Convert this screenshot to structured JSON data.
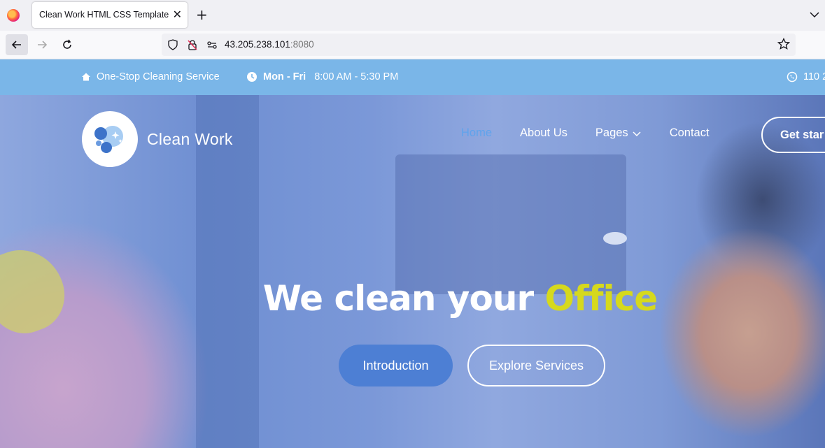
{
  "browser": {
    "tab_title": "Clean Work HTML CSS Template",
    "url_host": "43.205.238.101",
    "url_port": ":8080"
  },
  "topbar": {
    "service": "One-Stop Cleaning Service",
    "days": "Mon - Fri",
    "hours": "8:00 AM - 5:30 PM",
    "phone": "110 2"
  },
  "site": {
    "brand": "Clean Work"
  },
  "nav": {
    "items": [
      {
        "label": "Home",
        "active": true
      },
      {
        "label": "About Us"
      },
      {
        "label": "Pages"
      },
      {
        "label": "Contact"
      }
    ],
    "cta": "Get star"
  },
  "hero": {
    "headline_main": "We clean your ",
    "headline_accent": "Office",
    "btn_intro": "Introduction",
    "btn_explore": "Explore Services"
  },
  "colors": {
    "topbar_bg": "#7ab6e8",
    "accent_yellow": "#d6d91d",
    "primary_blue": "#4d7fd4",
    "nav_active": "#5fa3ec"
  }
}
